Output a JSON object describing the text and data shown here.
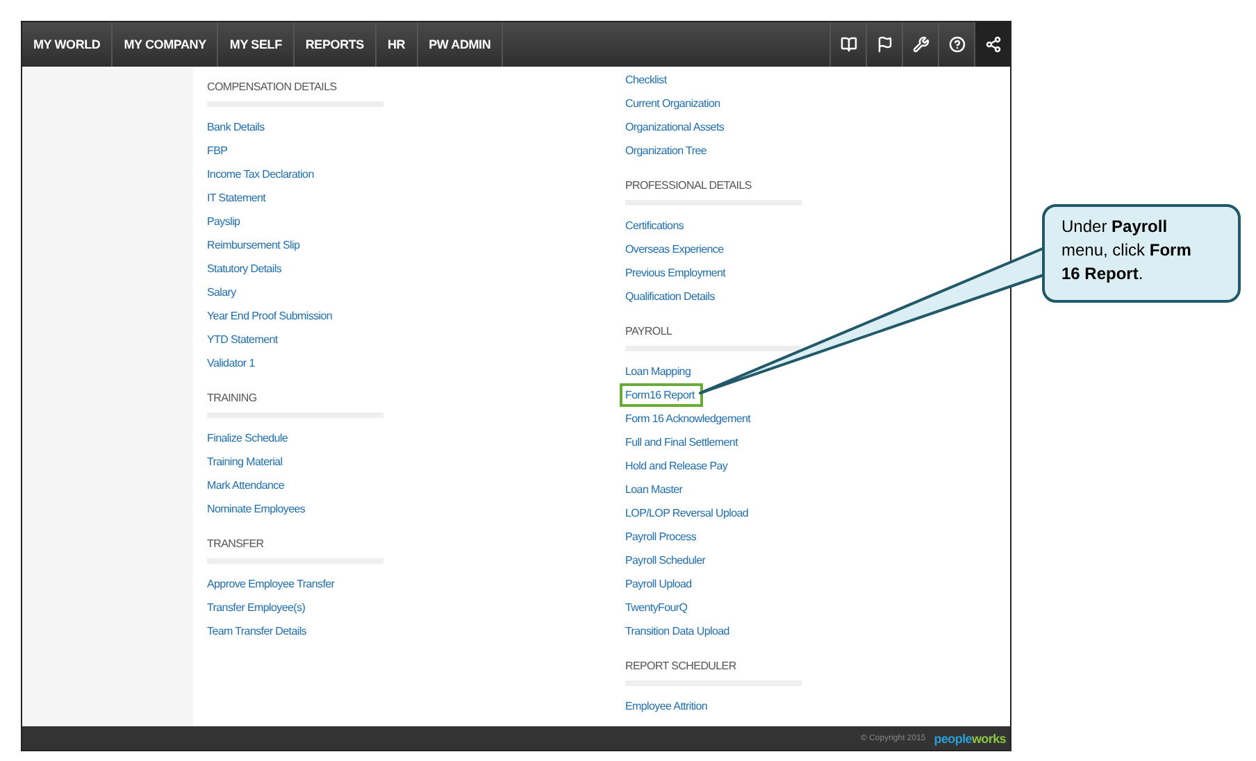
{
  "nav": {
    "tabs": [
      {
        "label": "MY WORLD"
      },
      {
        "label": "MY COMPANY"
      },
      {
        "label": "MY SELF"
      },
      {
        "label": "REPORTS"
      },
      {
        "label": "HR"
      },
      {
        "label": "PW ADMIN"
      }
    ],
    "icons": [
      {
        "kind": "book",
        "selected": false
      },
      {
        "kind": "flag",
        "selected": false
      },
      {
        "kind": "tools",
        "selected": false
      },
      {
        "kind": "help",
        "selected": false
      },
      {
        "kind": "share",
        "selected": true
      }
    ]
  },
  "columns": [
    {
      "sections": [
        {
          "heading": "COMPENSATION DETAILS",
          "items": [
            {
              "label": "Bank Details",
              "highlighted": false
            },
            {
              "label": "FBP",
              "highlighted": false
            },
            {
              "label": "Income Tax Declaration",
              "highlighted": false
            },
            {
              "label": "IT Statement",
              "highlighted": false
            },
            {
              "label": "Payslip",
              "highlighted": false
            },
            {
              "label": "Reimbursement Slip",
              "highlighted": false
            },
            {
              "label": "Statutory Details",
              "highlighted": false
            },
            {
              "label": "Salary",
              "highlighted": false
            },
            {
              "label": "Year End Proof Submission",
              "highlighted": false
            },
            {
              "label": "YTD Statement",
              "highlighted": false
            },
            {
              "label": "Validator 1",
              "highlighted": false
            }
          ]
        },
        {
          "heading": "TRAINING",
          "items": [
            {
              "label": "Finalize Schedule",
              "highlighted": false
            },
            {
              "label": "Training Material",
              "highlighted": false
            },
            {
              "label": "Mark Attendance",
              "highlighted": false
            },
            {
              "label": "Nominate Employees",
              "highlighted": false
            }
          ]
        },
        {
          "heading": "TRANSFER",
          "items": [
            {
              "label": "Approve Employee Transfer",
              "highlighted": false
            },
            {
              "label": "Transfer Employee(s)",
              "highlighted": false
            },
            {
              "label": "Team Transfer Details",
              "highlighted": false
            }
          ]
        }
      ]
    },
    {
      "sections": [
        {
          "items": [
            {
              "label": "Checklist",
              "highlighted": false
            },
            {
              "label": "Current Organization",
              "highlighted": false
            },
            {
              "label": "Organizational Assets",
              "highlighted": false
            },
            {
              "label": "Organization Tree",
              "highlighted": false
            }
          ]
        },
        {
          "heading": "PROFESSIONAL DETAILS",
          "items": [
            {
              "label": "Certifications",
              "highlighted": false
            },
            {
              "label": "Overseas Experience",
              "highlighted": false
            },
            {
              "label": "Previous Employment",
              "highlighted": false
            },
            {
              "label": "Qualification Details",
              "highlighted": false
            }
          ]
        },
        {
          "heading": "PAYROLL",
          "items": [
            {
              "label": "Loan Mapping",
              "highlighted": false
            },
            {
              "label": "Form16 Report",
              "highlighted": true
            },
            {
              "label": "Form 16 Acknowledgement",
              "highlighted": false
            },
            {
              "label": "Full and Final Settlement",
              "highlighted": false
            },
            {
              "label": "Hold and Release Pay",
              "highlighted": false
            },
            {
              "label": "Loan Master",
              "highlighted": false
            },
            {
              "label": "LOP/LOP Reversal Upload",
              "highlighted": false
            },
            {
              "label": "Payroll Process",
              "highlighted": false
            },
            {
              "label": "Payroll Scheduler",
              "highlighted": false
            },
            {
              "label": "Payroll Upload",
              "highlighted": false
            },
            {
              "label": "TwentyFourQ",
              "highlighted": false
            },
            {
              "label": "Transition Data Upload",
              "highlighted": false
            }
          ]
        },
        {
          "heading": "REPORT SCHEDULER",
          "items": [
            {
              "label": "Employee Attrition",
              "highlighted": false
            }
          ]
        }
      ]
    }
  ],
  "footer": {
    "copyright": "© Copyright 2015",
    "logo": [
      {
        "text": "people",
        "color": "#2a9fd6"
      },
      {
        "text": "works",
        "color": "#8dc63f"
      }
    ]
  },
  "callout": {
    "text": "Under **Payroll** menu, click **Form 16 Report**."
  }
}
